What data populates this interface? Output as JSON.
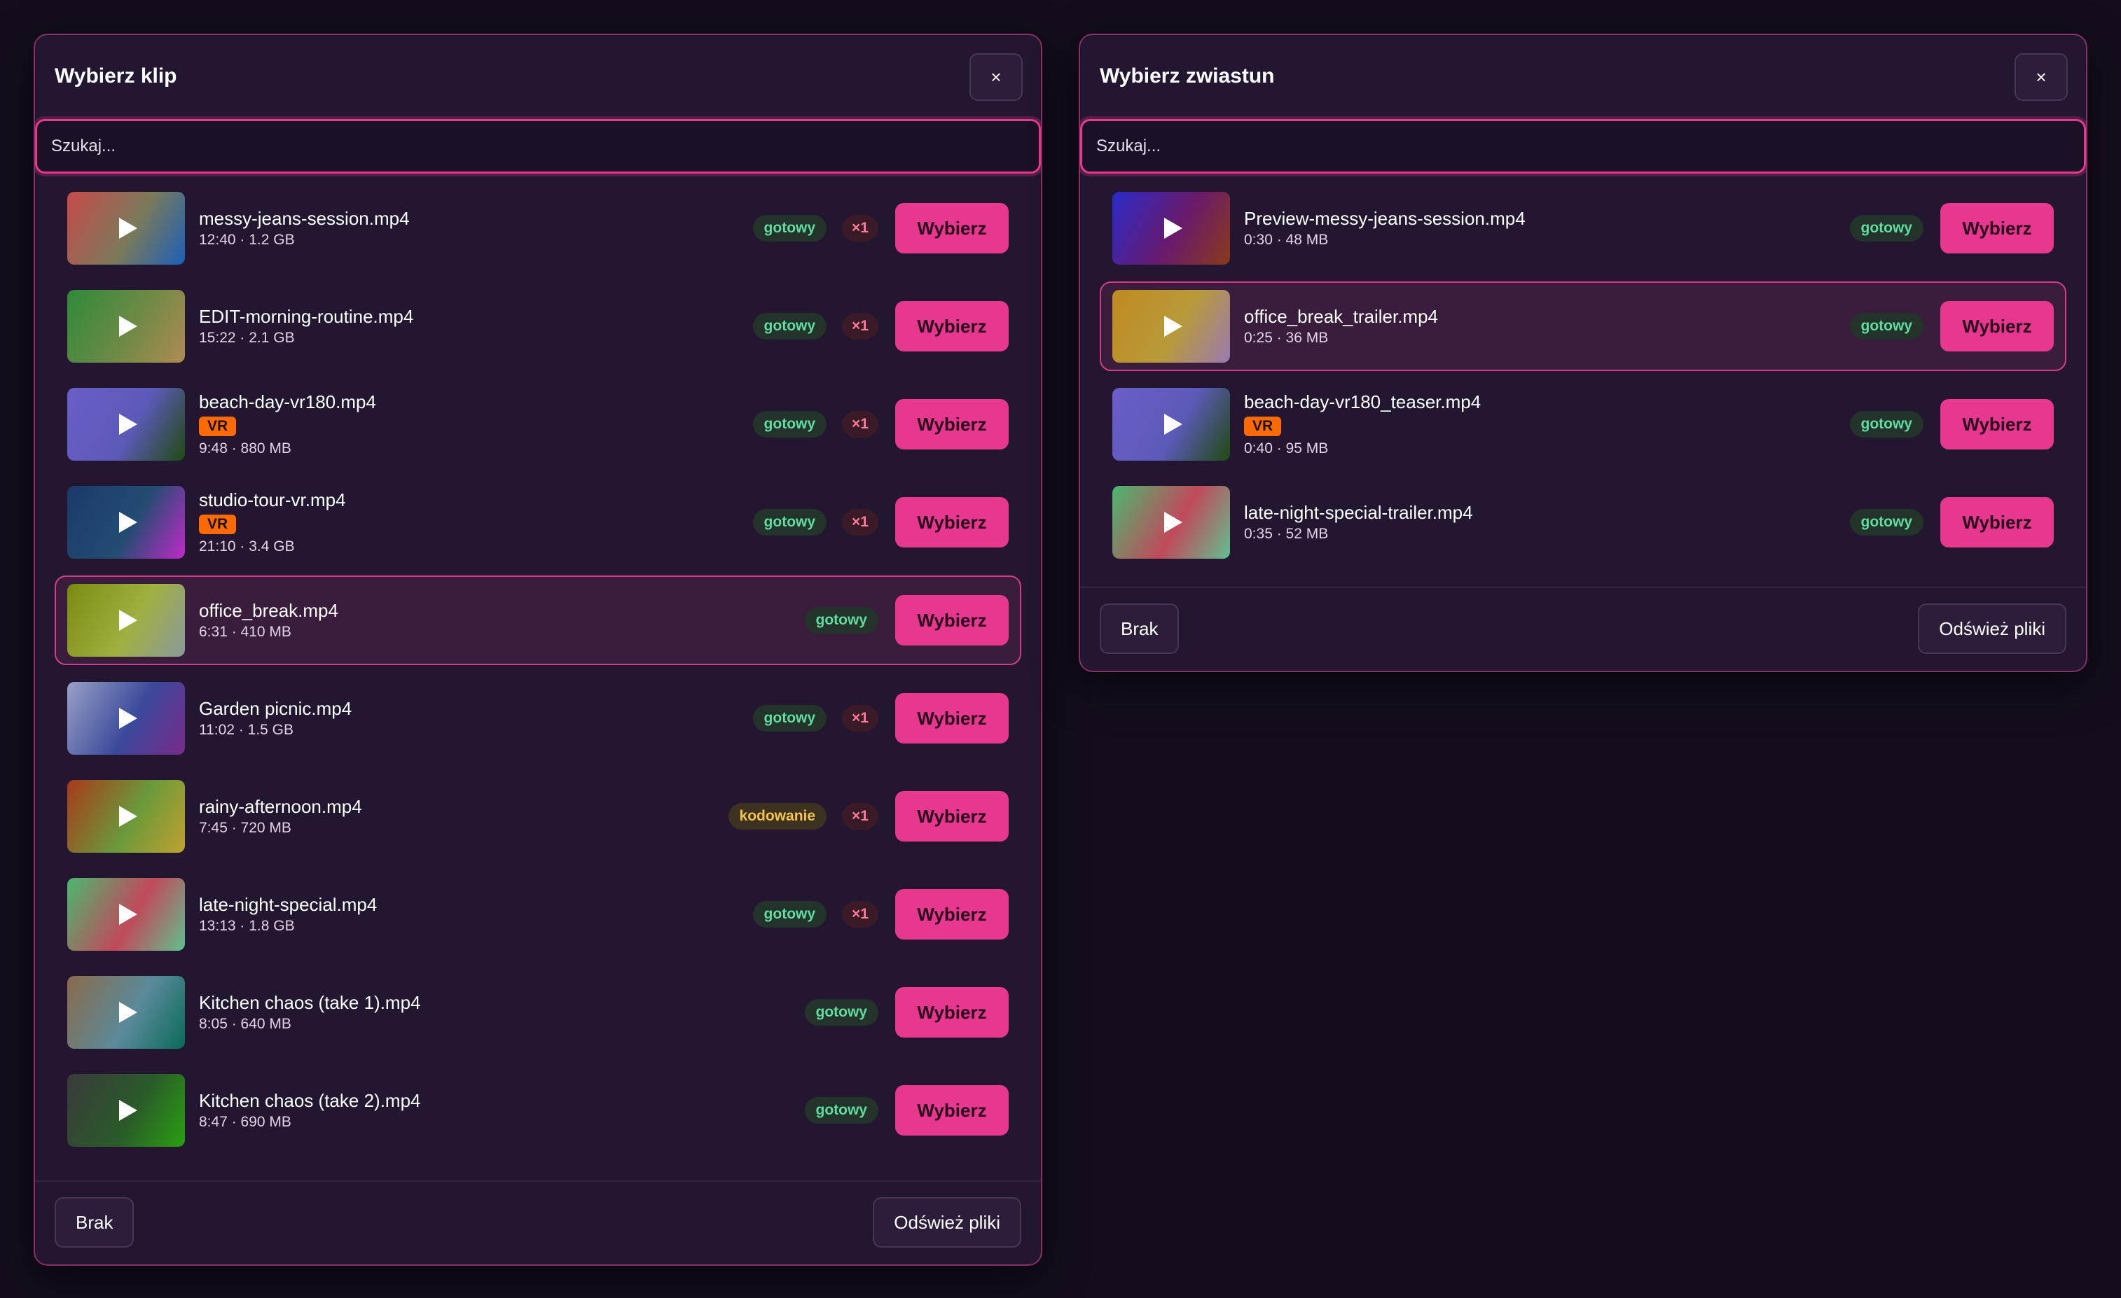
{
  "clip_modal": {
    "title": "Wybierz klip",
    "close_label": "×",
    "search_placeholder": "Szukaj...",
    "none_label": "Brak",
    "refresh_label": "Odśwież pliki",
    "items": [
      {
        "name": "messy-jeans-session.mp4",
        "meta": "12:40 · 1.2 GB",
        "vr": "",
        "status": "gotowy",
        "count": "×1",
        "action": "Wybierz",
        "selected": false,
        "thumb": [
          "#c74a4a",
          "#7a7a5a",
          "#1c5fb8"
        ]
      },
      {
        "name": "EDIT-morning-routine.mp4",
        "meta": "15:22 · 2.1 GB",
        "vr": "",
        "status": "gotowy",
        "count": "×1",
        "action": "Wybierz",
        "selected": false,
        "thumb": [
          "#2e8a3a",
          "#6f8a45",
          "#b08a55"
        ]
      },
      {
        "name": "beach-day-vr180.mp4",
        "meta": "9:48 · 880 MB",
        "vr": "VR",
        "status": "gotowy",
        "count": "×1",
        "action": "Wybierz",
        "selected": false,
        "thumb": [
          "#6a5ec8",
          "#5c5ab8",
          "#1f4a10"
        ]
      },
      {
        "name": "studio-tour-vr.mp4",
        "meta": "21:10 · 3.4 GB",
        "vr": "VR",
        "status": "gotowy",
        "count": "×1",
        "action": "Wybierz",
        "selected": false,
        "thumb": [
          "#1a3a6a",
          "#234c72",
          "#c02ac8"
        ]
      },
      {
        "name": "office_break.mp4",
        "meta": "6:31 · 410 MB",
        "vr": "",
        "status": "gotowy",
        "count": "",
        "action": "Wybierz",
        "selected": true,
        "thumb": [
          "#7a8a10",
          "#a0b040",
          "#8a9a9a"
        ]
      },
      {
        "name": "Garden picnic.mp4",
        "meta": "11:02 · 1.5 GB",
        "vr": "",
        "status": "gotowy",
        "count": "×1",
        "action": "Wybierz",
        "selected": false,
        "thumb": [
          "#9aa0c8",
          "#3a4a9a",
          "#7a2a8a"
        ]
      },
      {
        "name": "rainy-afternoon.mp4",
        "meta": "7:45 · 720 MB",
        "vr": "",
        "status": "kodowanie",
        "count": "×1",
        "action": "Wybierz",
        "selected": false,
        "thumb": [
          "#a83a1a",
          "#6a9a3a",
          "#c0a030"
        ]
      },
      {
        "name": "late-night-special.mp4",
        "meta": "13:13 · 1.8 GB",
        "vr": "",
        "status": "gotowy",
        "count": "×1",
        "action": "Wybierz",
        "selected": false,
        "thumb": [
          "#4ab870",
          "#c04a5a",
          "#60c090"
        ]
      },
      {
        "name": "Kitchen chaos (take 1).mp4",
        "meta": "8:05 · 640 MB",
        "vr": "",
        "status": "gotowy",
        "count": "",
        "action": "Wybierz",
        "selected": false,
        "thumb": [
          "#8a6a4a",
          "#5a8a9a",
          "#0a6a5a"
        ]
      },
      {
        "name": "Kitchen chaos (take 2).mp4",
        "meta": "8:47 · 690 MB",
        "vr": "",
        "status": "gotowy",
        "count": "",
        "action": "Wybierz",
        "selected": false,
        "thumb": [
          "#3a3a3a",
          "#2a5a2a",
          "#2aa010"
        ]
      }
    ]
  },
  "trailer_modal": {
    "title": "Wybierz zwiastun",
    "close_label": "×",
    "search_placeholder": "Szukaj...",
    "none_label": "Brak",
    "refresh_label": "Odśwież pliki",
    "items": [
      {
        "name": "Preview-messy-jeans-session.mp4",
        "meta": "0:30 · 48 MB",
        "vr": "",
        "status": "gotowy",
        "count": "",
        "action": "Wybierz",
        "selected": false,
        "thumb": [
          "#2a2ac8",
          "#6a1a6a",
          "#8a3a1a"
        ]
      },
      {
        "name": "office_break_trailer.mp4",
        "meta": "0:25 · 36 MB",
        "vr": "",
        "status": "gotowy",
        "count": "",
        "action": "Wybierz",
        "selected": true,
        "thumb": [
          "#c08a20",
          "#b89a3a",
          "#9a7ab0"
        ]
      },
      {
        "name": "beach-day-vr180_teaser.mp4",
        "meta": "0:40 · 95 MB",
        "vr": "VR",
        "status": "gotowy",
        "count": "",
        "action": "Wybierz",
        "selected": false,
        "thumb": [
          "#6a5ec8",
          "#5c5ab8",
          "#1f4a10"
        ]
      },
      {
        "name": "late-night-special-trailer.mp4",
        "meta": "0:35 · 52 MB",
        "vr": "",
        "status": "gotowy",
        "count": "",
        "action": "Wybierz",
        "selected": false,
        "thumb": [
          "#4ab870",
          "#c04a5a",
          "#60c090"
        ]
      }
    ]
  }
}
